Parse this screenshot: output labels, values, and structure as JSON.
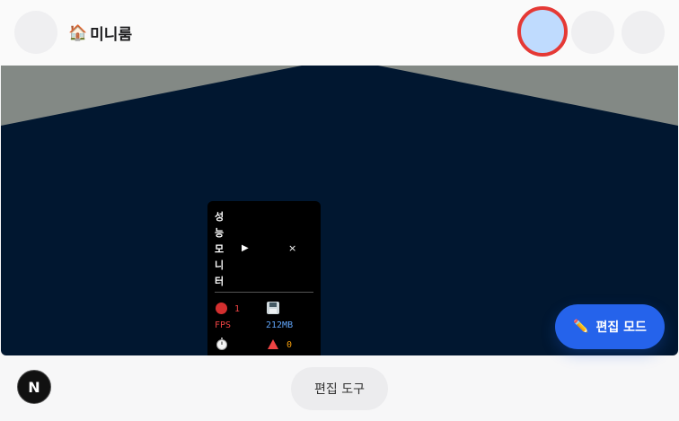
{
  "header": {
    "icon": "house-icon",
    "house_glyph": "🏠",
    "title": "미니룸"
  },
  "perf_monitor": {
    "title": "성능모니터",
    "play": "▶",
    "close": "×",
    "fps_value": "1",
    "fps_label": "FPS",
    "memory_value": "212MB",
    "timer_value": "",
    "warning_value": "0"
  },
  "actions": {
    "edit_mode_icon": "✏️",
    "edit_mode_label": "편집 모드",
    "edit_tools_label": "편집 도구",
    "n_badge": "N"
  },
  "colors": {
    "accent": "#2563eb",
    "active_ring": "#e53935",
    "active_fill": "#bfdbfe",
    "scene_floor": "#011730",
    "scene_wall": "#838985",
    "fps": "#ef4444",
    "memory": "#60a5fa",
    "warning": "#f59e0b"
  }
}
